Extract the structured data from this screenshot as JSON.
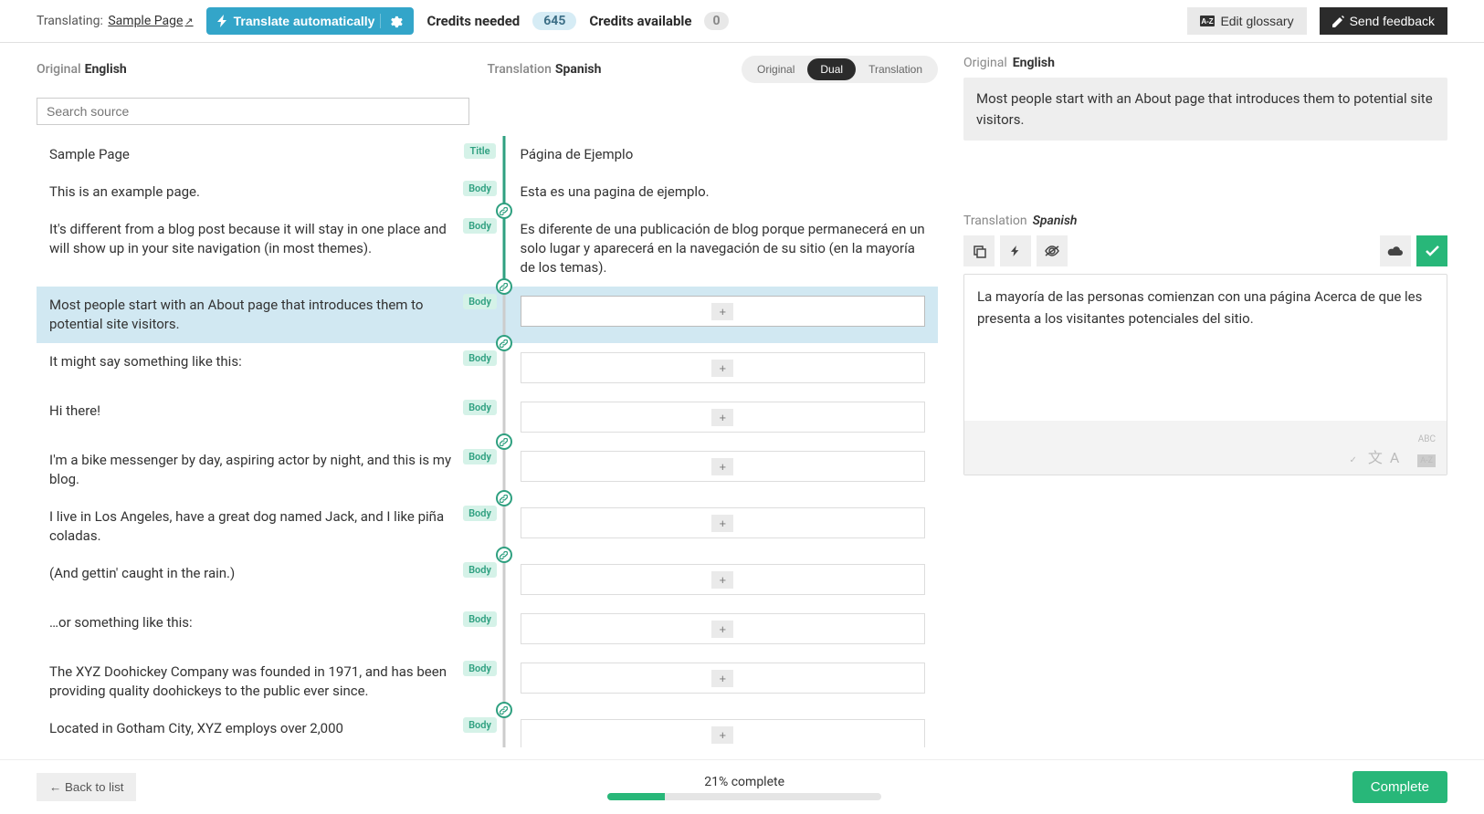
{
  "topbar": {
    "translating_label": "Translating:",
    "page_name": "Sample Page",
    "translate_auto_label": "Translate automatically",
    "credits_needed_label": "Credits needed",
    "credits_needed_value": "645",
    "credits_available_label": "Credits available",
    "credits_available_value": "0",
    "edit_glossary_label": "Edit glossary",
    "send_feedback_label": "Send feedback"
  },
  "headers": {
    "original_label": "Original",
    "original_lang": "English",
    "translation_label": "Translation",
    "translation_lang": "Spanish",
    "search_placeholder": "Search source"
  },
  "view_toggle": {
    "original": "Original",
    "dual": "Dual",
    "translation": "Translation"
  },
  "tags": {
    "title": "Title",
    "body": "Body"
  },
  "segments": [
    {
      "src": "Sample Page",
      "tag": "Title",
      "tgt": "Página de Ejemplo",
      "has_box": false,
      "link_dot": false
    },
    {
      "src": "This is an example page.",
      "tag": "Body",
      "tgt": "Esta es una pagina de ejemplo.",
      "has_box": false,
      "link_dot": true
    },
    {
      "src": "It's different from a blog post because it will stay in one place and will show up in your site navigation (in most themes).",
      "tag": "Body",
      "tgt": "Es diferente de una publicación de blog porque permanecerá en un solo lugar y aparecerá en la navegación de su sitio (en la mayoría de los temas).",
      "has_box": false,
      "link_dot": true
    },
    {
      "src": "Most people start with an About page that introduces them to potential site visitors.",
      "tag": "Body",
      "tgt": "",
      "has_box": true,
      "highlight": true,
      "link_dot": true
    },
    {
      "src": "It might say something like this:",
      "tag": "Body",
      "tgt": "",
      "has_box": true,
      "link_dot": false
    },
    {
      "src": "Hi there!",
      "tag": "Body",
      "tgt": "",
      "has_box": true,
      "link_dot": true
    },
    {
      "src": "I'm a bike messenger by day, aspiring actor by night, and this is my blog.",
      "tag": "Body",
      "tgt": "",
      "has_box": true,
      "link_dot": true
    },
    {
      "src": "I live in Los Angeles, have a great dog named Jack, and I like piña coladas.",
      "tag": "Body",
      "tgt": "",
      "has_box": true,
      "link_dot": true
    },
    {
      "src": "(And gettin' caught in the rain.)",
      "tag": "Body",
      "tgt": "",
      "has_box": true,
      "link_dot": false
    },
    {
      "src": "…or something like this:",
      "tag": "Body",
      "tgt": "",
      "has_box": true,
      "link_dot": false
    },
    {
      "src": "The XYZ Doohickey Company was founded in 1971, and has been providing quality doohickeys to the public ever since.",
      "tag": "Body",
      "tgt": "",
      "has_box": true,
      "link_dot": true
    },
    {
      "src": "Located in Gotham City, XYZ employs over 2,000",
      "tag": "Body",
      "tgt": "",
      "has_box": true,
      "link_dot": false
    }
  ],
  "detail": {
    "original_label": "Original",
    "original_lang": "English",
    "src_text": "Most people start with an About page that introduces them to potential site visitors.",
    "translation_label": "Translation",
    "translation_lang": "Spanish",
    "tgt_text": "La mayoría de las personas comienzan con una página Acerca de que les presenta a los visitantes potenciales del sitio."
  },
  "footer": {
    "back_label": "Back to list",
    "progress_percent": 21,
    "progress_label": "21% complete",
    "complete_label": "Complete"
  },
  "icons": {
    "plus": "+",
    "arrow_left": "←"
  }
}
